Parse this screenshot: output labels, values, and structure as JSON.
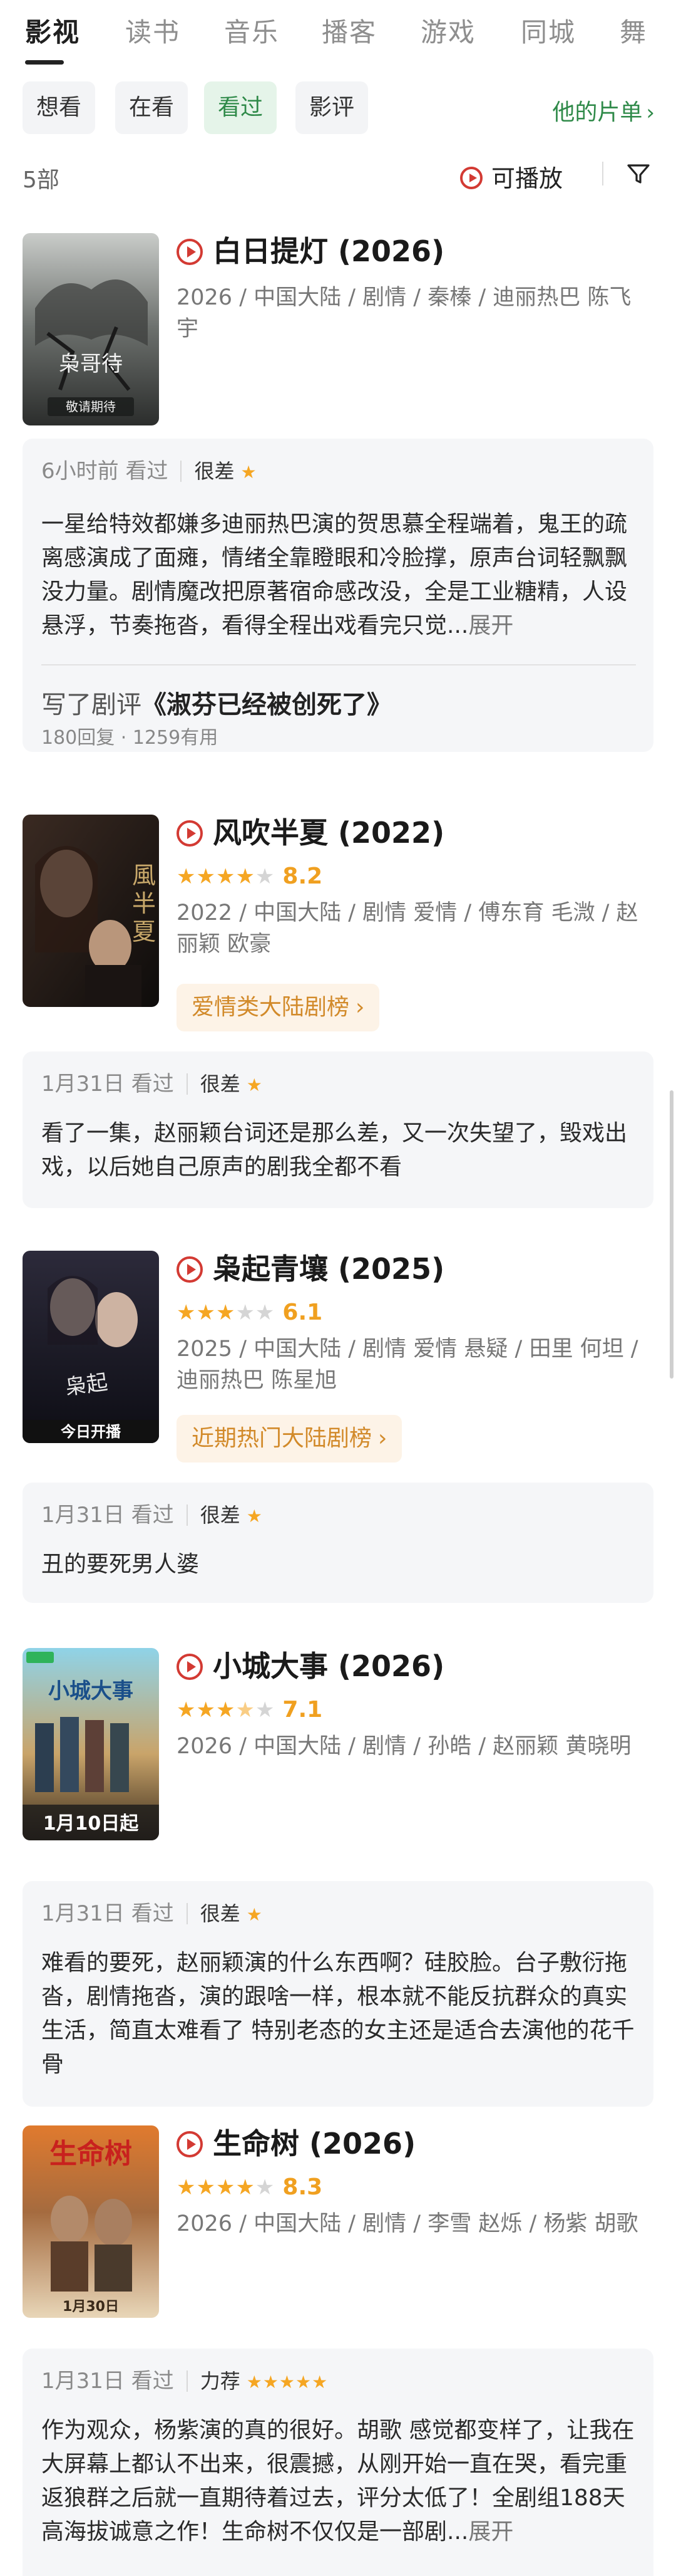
{
  "category_tabs": [
    "影视",
    "读书",
    "音乐",
    "播客",
    "游戏",
    "同城",
    "舞"
  ],
  "sub_tabs": [
    "想看",
    "在看",
    "看过",
    "影评"
  ],
  "his_list_label": "他的片单",
  "count_label": "5部",
  "play_filter_label": "可播放",
  "colors": {
    "accent_green": "#2f8a49",
    "play_red": "#d33a33",
    "star": "#f5a623"
  },
  "movies": [
    {
      "title": "白日提灯 (2026)",
      "meta": "2026 / 中国大陆 / 剧情 / 秦榛 / 迪丽热巴 陈飞宇",
      "poster_caption": "敬请期待",
      "review": {
        "time": "6小时前 看过",
        "grade": "很差",
        "stars": 1,
        "text": "一星给特效都嫌多迪丽热巴演的贺思慕全程端着，鬼王的疏离感演成了面瘫，情绪全靠瞪眼和冷脸撑，原声台词轻飘飘没力量。剧情魔改把原著宿命感改没，全是工业糖精，人设悬浮，节奏拖沓，看得全程出戏看完只觉...",
        "expand": "展开",
        "article_prefix": "写了剧评",
        "article_title": "《淑芬已经被创死了》",
        "article_stats": "180回复 · 1259有用"
      }
    },
    {
      "title": "风吹半夏 (2022)",
      "stars": 4,
      "score": "8.2",
      "meta": "2022 / 中国大陆 / 剧情 爱情 / 傅东育 毛溦 / 赵丽颖 欧豪",
      "rank": "爱情类大陆剧榜",
      "review": {
        "time": "1月31日 看过",
        "grade": "很差",
        "stars": 1,
        "text": "看了一集，赵丽颖台词还是那么差，又一次失望了，毁戏出戏，以后她自己原声的剧我全都不看"
      }
    },
    {
      "title": "枭起青壤 (2025)",
      "stars": 3,
      "score": "6.1",
      "meta": "2025 / 中国大陆 / 剧情 爱情 悬疑 / 田里 何坦 / 迪丽热巴 陈星旭",
      "poster_caption": "今日开播",
      "rank": "近期热门大陆剧榜",
      "review": {
        "time": "1月31日 看过",
        "grade": "很差",
        "stars": 1,
        "text": "丑的要死男人婆"
      }
    },
    {
      "title": "小城大事 (2026)",
      "stars": 3.5,
      "score": "7.1",
      "meta": "2026 / 中国大陆 / 剧情 / 孙皓 / 赵丽颖 黄晓明",
      "poster_caption": "1月10日起",
      "review": {
        "time": "1月31日 看过",
        "grade": "很差",
        "stars": 1,
        "text": "难看的要死，赵丽颖演的什么东西啊？硅胶脸。台子敷衍拖沓，剧情拖沓，演的跟啥一样，根本就不能反抗群众的真实生活，简直太难看了 特别老态的女主还是适合去演他的花千骨"
      }
    },
    {
      "title": "生命树 (2026)",
      "stars": 4,
      "score": "8.3",
      "meta": "2026 / 中国大陆 / 剧情 / 李雪 赵烁 / 杨紫 胡歌",
      "poster_caption": "1月30日",
      "review": {
        "time": "1月31日 看过",
        "grade": "力荐",
        "stars": 5,
        "text": "作为观众，杨紫演的真的很好。胡歌 感觉都变样了，让我在大屏幕上都认不出来，很震撼，从刚开始一直在哭，看完重返狼群之后就一直期待着过去，评分太低了！全剧组188天高海拔诚意之作！生命树不仅仅是一部剧...",
        "expand": "展开"
      }
    }
  ]
}
